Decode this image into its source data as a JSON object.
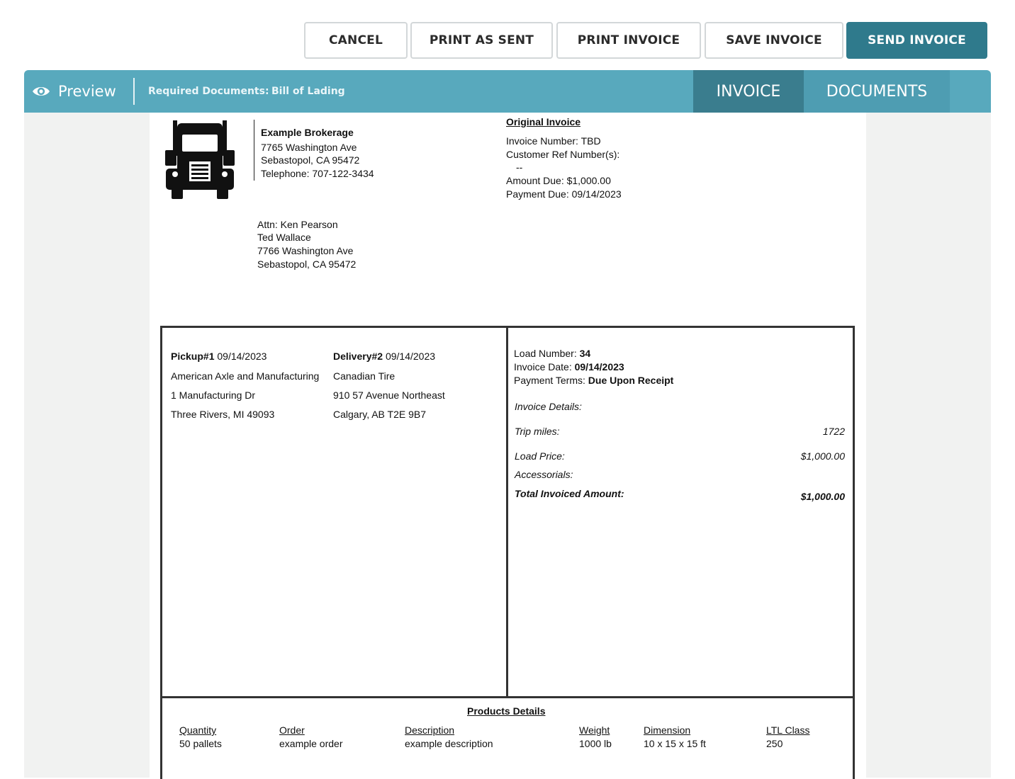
{
  "actions": {
    "cancel": "CANCEL",
    "print_as_sent": "PRINT AS SENT",
    "print_invoice": "PRINT INVOICE",
    "save_invoice": "SAVE INVOICE",
    "send_invoice": "SEND INVOICE"
  },
  "preview_bar": {
    "preview_label": "Preview",
    "required_label": "Required Documents:",
    "required_doc": "Bill of Lading",
    "tabs": [
      {
        "label": "INVOICE",
        "active": true
      },
      {
        "label": "DOCUMENTS",
        "active": false
      }
    ]
  },
  "invoice": {
    "company": {
      "name": "Example Brokerage",
      "address1": "7765 Washington Ave",
      "address2": "Sebastopol, CA 95472",
      "phone": "Telephone: 707-122-3434"
    },
    "header": {
      "title": "Original Invoice",
      "invoice_number": "Invoice Number: TBD",
      "customer_ref": "Customer Ref Number(s):",
      "customer_ref_value": "--",
      "amount_due": "Amount Due: $1,000.00",
      "payment_due": "Payment Due: 09/14/2023"
    },
    "bill_to": {
      "attn": "Attn: Ken Pearson",
      "name": "Ted Wallace",
      "address1": "7766 Washington Ave",
      "address2": "Sebastopol, CA 95472"
    },
    "pickup": {
      "label": "Pickup#1",
      "date": "09/14/2023",
      "name": "American Axle and Manufacturing",
      "address1": "1 Manufacturing Dr",
      "address2": "Three Rivers, MI 49093"
    },
    "delivery": {
      "label": "Delivery#2",
      "date": "09/14/2023",
      "name": "Canadian Tire",
      "address1": "910 57 Avenue Northeast",
      "address2": "Calgary, AB T2E 9B7"
    },
    "load": {
      "load_number_label": "Load Number:",
      "load_number": "34",
      "invoice_date_label": "Invoice Date:",
      "invoice_date": "09/14/2023",
      "terms_label": "Payment Terms:",
      "terms": "Due Upon Receipt",
      "details_label": "Invoice Details:",
      "trip_miles_label": "Trip miles:",
      "trip_miles": "1722",
      "load_price_label": "Load Price:",
      "load_price": "$1,000.00",
      "accessorials_label": "Accessorials:",
      "total_label": "Total Invoiced Amount:",
      "total": "$1,000.00"
    },
    "products": {
      "title": "Products Details",
      "columns": [
        "Quantity",
        "Order",
        "Description",
        "Weight",
        "Dimension",
        "LTL Class"
      ],
      "rows": [
        [
          "50 pallets",
          "example order",
          "example description",
          "1000 lb",
          "10 x 15 x 15 ft",
          "250"
        ]
      ]
    }
  }
}
